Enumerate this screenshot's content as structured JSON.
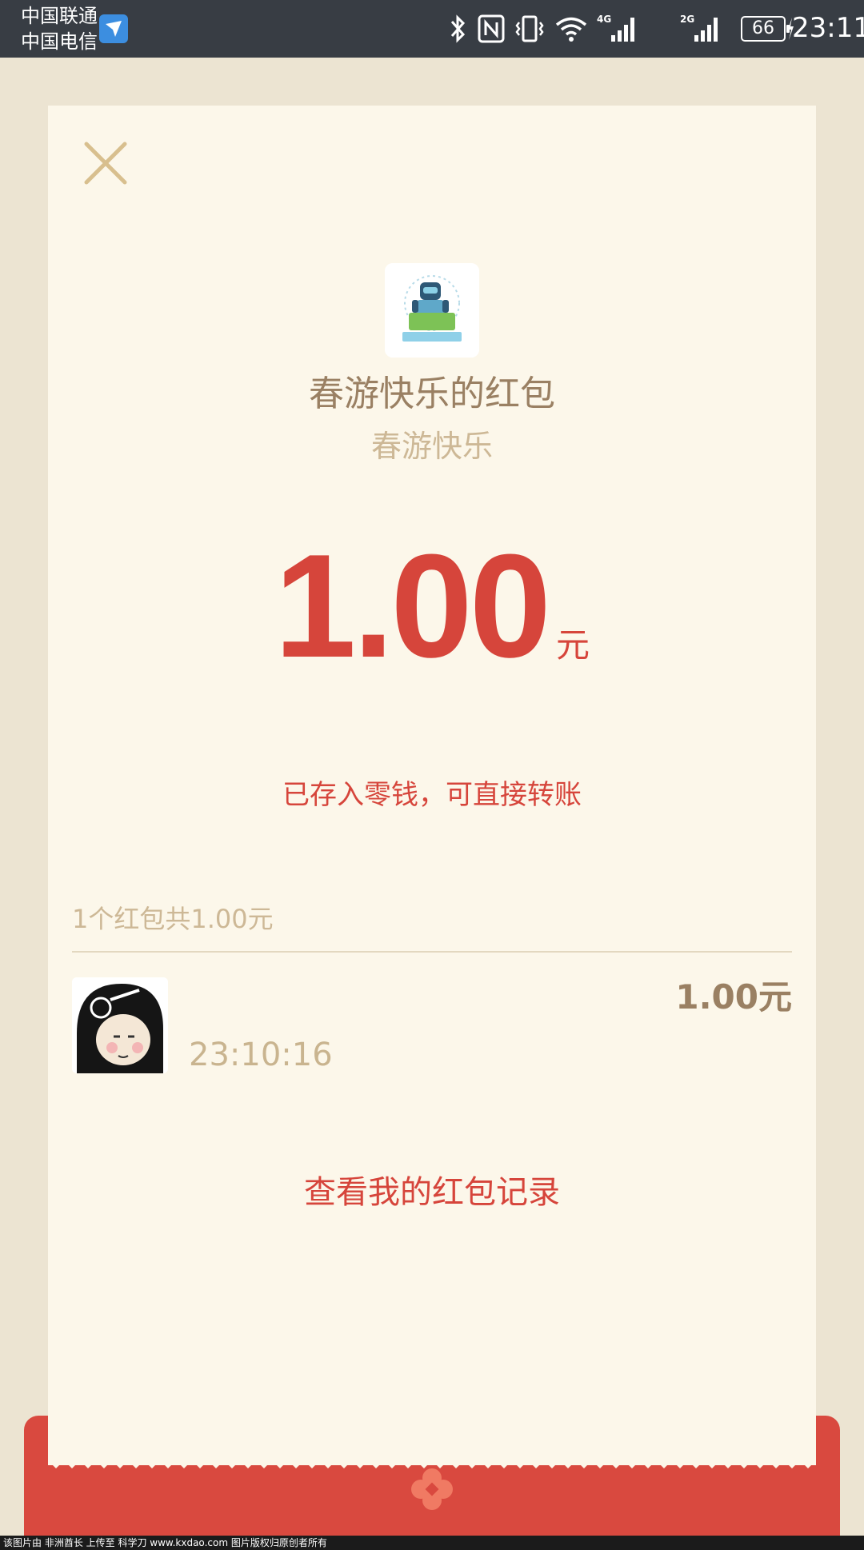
{
  "status_bar": {
    "carrier_1": "中国联通",
    "carrier_2": "中国电信",
    "battery": "66",
    "network_1": "4G",
    "network_2": "2G",
    "time": "23:11",
    "icons": [
      "carrier-app-icon",
      "bluetooth-icon",
      "nfc-icon",
      "vibrate-icon",
      "wifi-icon",
      "signal-4g-icon",
      "signal-2g-icon",
      "battery-icon",
      "charging-icon"
    ]
  },
  "packet": {
    "title": "春游快乐的红包",
    "subtitle": "春游快乐",
    "amount": "1.00",
    "unit": "元",
    "saved_note": "已存入零钱，可直接转账"
  },
  "records": {
    "summary": "1个红包共1.00元",
    "items": [
      {
        "time": "23:10:16",
        "amount": "1.00元"
      }
    ]
  },
  "history_link": "查看我的红包记录",
  "watermark": "该图片由  非洲酋长  上传至  科学刀  www.kxdao.com  图片版权归原创者所有",
  "colors": {
    "accent_red": "#d6453b",
    "gold_text": "#9a8063",
    "card_bg": "#fcf7ea",
    "page_bg": "#ece4d2"
  }
}
